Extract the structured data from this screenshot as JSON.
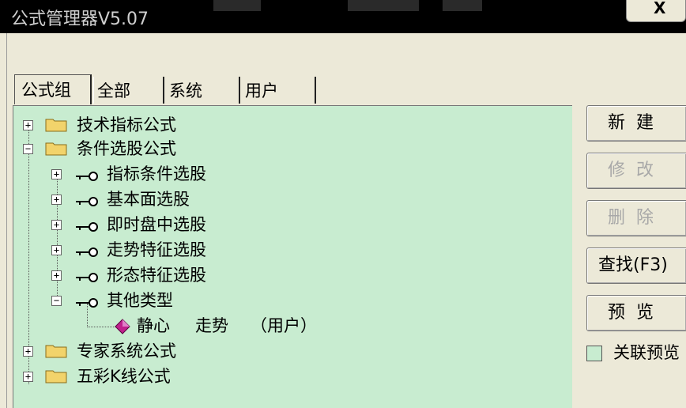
{
  "window": {
    "title": "公式管理器V5.07",
    "close_label": "X"
  },
  "tabs": [
    "公式组",
    "全部",
    "系统",
    "用户"
  ],
  "tree": {
    "technical": "技术指标公式",
    "conditions": "条件选股公式",
    "cond_children": [
      "指标条件选股",
      "基本面选股",
      "即时盘中选股",
      "走势特征选股",
      "形态特征选股",
      "其他类型"
    ],
    "formula_name": "静心",
    "formula_desc": "走势",
    "formula_owner": "（用户）",
    "expert": "专家系统公式",
    "colorful_k": "五彩K线公式"
  },
  "buttons": {
    "new": "新建",
    "modify": "修改",
    "delete": "删除",
    "find": "查找(F3)",
    "preview": "预览"
  },
  "options": {
    "link_preview": "关联预览"
  },
  "colors": {
    "tree_bg": "#c8ecd0",
    "folder": "#f2d36b",
    "formula_icon": "#c0208c"
  }
}
